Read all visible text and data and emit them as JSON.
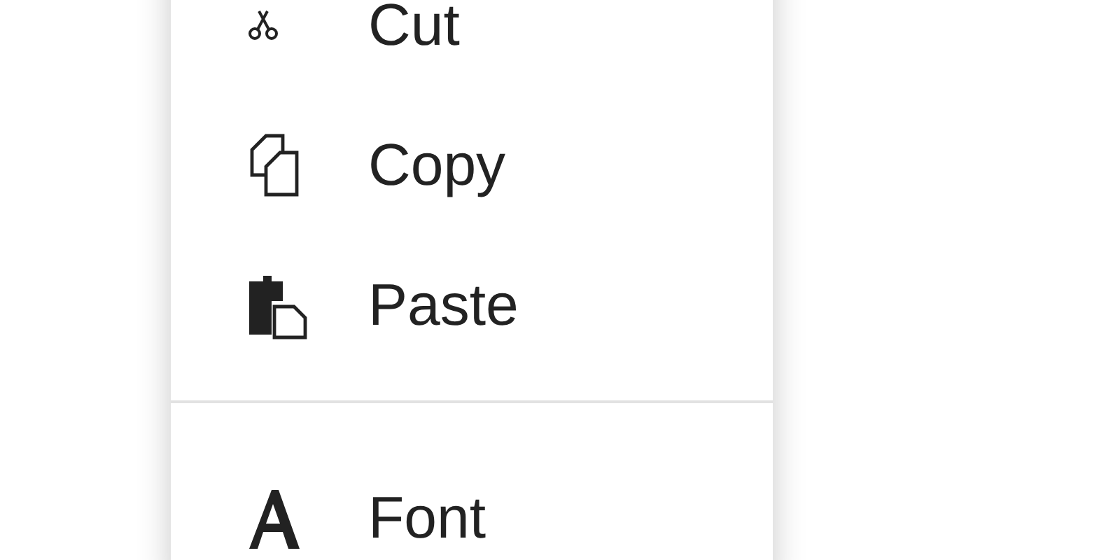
{
  "menu": {
    "items": [
      {
        "kind": "cut",
        "label": "Cut"
      },
      {
        "kind": "copy",
        "label": "Copy"
      },
      {
        "kind": "paste",
        "label": "Paste"
      },
      {
        "kind": "divider"
      },
      {
        "kind": "font",
        "label": "Font"
      }
    ]
  }
}
